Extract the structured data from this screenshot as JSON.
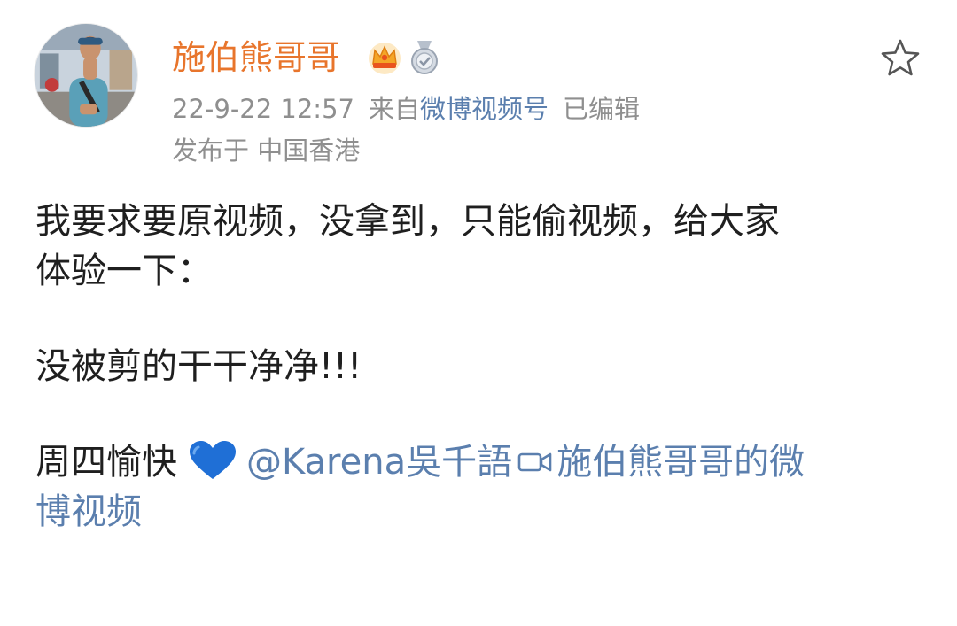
{
  "post": {
    "author": {
      "name": "施伯熊哥哥",
      "badges": [
        "crown-icon",
        "medal-icon"
      ],
      "avatar": "avatar-photo"
    },
    "favorite_icon": "star-outline-icon",
    "meta": {
      "timestamp": "22-9-22 12:57",
      "source_prefix": "来自",
      "source_name": "微博视频号",
      "edited_label": "已编辑",
      "location": "发布于 中国香港"
    },
    "content": {
      "line1": "我要求要原视频，没拿到，只能偷视频，给大家",
      "line2": "体验一下：",
      "line3": "没被剪的干干净净!!!",
      "closing_text": "周四愉快",
      "heart_icon": "blue-heart-icon",
      "mention": "@Karena吳千語",
      "video_icon": "video-camera-icon",
      "video_link_part1": "施伯熊哥哥的微",
      "video_link_part2": "博视频"
    },
    "colors": {
      "username": "#e8752c",
      "link": "#5b7fae",
      "meta": "#8f8f8f",
      "text": "#1f1f1f",
      "heart": "#1f6fd6"
    }
  }
}
